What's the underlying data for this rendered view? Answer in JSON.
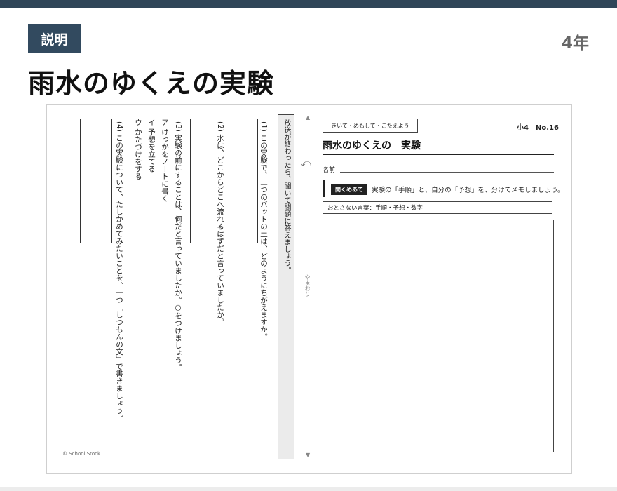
{
  "header": {
    "badge": "説明",
    "grade": "4年",
    "title": "雨水のゆくえの実験"
  },
  "sheet": {
    "instruction": "放送が終わったら、聞いて問題に答えましょう。",
    "questions": [
      "(1) この実験で、二つのバットの土は、どのようにちがえますか。",
      "(2) 水は、どこからどこへ流れるはずだと言っていましたか。",
      "(3) 実験の前にすることは、何だと言っていましたか。○をつけましょう。",
      "ア けっかをノートに書く",
      "イ 予想を立てる",
      "ウ かたづけをする",
      "(4) この実験について、たしかめてみたいことを、一つ「しつもんの文」で書きましょう。"
    ],
    "fold_label": "やまおり",
    "copyright": "© School Stock",
    "ws_label": "きいて・めもして・こたえよう",
    "ws_number": "小4　No.16",
    "ws_title": "雨水のゆくえの　実験",
    "name_label": "名前",
    "listen_label": "聞くめあて",
    "listen_text": "実験の「手順」と、自分の「予想」を、分けてメモしましょう。",
    "keywords": "おとさない言葉：手順・予想・数字"
  }
}
